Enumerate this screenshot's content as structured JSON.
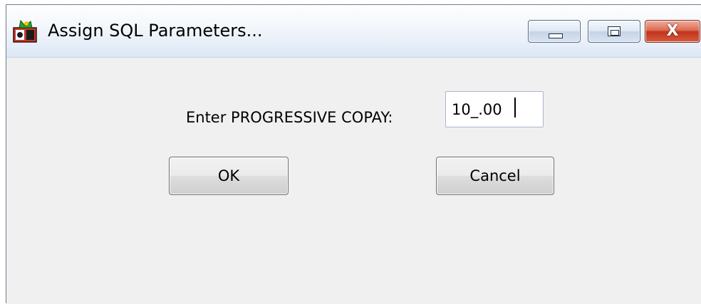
{
  "window": {
    "title": "Assign SQL Parameters...",
    "controls": {
      "minimize_icon": "minimize-icon",
      "maximize_icon": "maximize-icon",
      "close_icon": "close-icon",
      "close_glyph": "X"
    }
  },
  "form": {
    "prompt": "Enter PROGRESSIVE COPAY:",
    "value": "10_.00"
  },
  "buttons": {
    "ok": "OK",
    "cancel": "Cancel"
  },
  "colors": {
    "dialog_background": "#f0f0f0",
    "close_button": "#c2341b",
    "input_border": "#a9b7c9"
  }
}
